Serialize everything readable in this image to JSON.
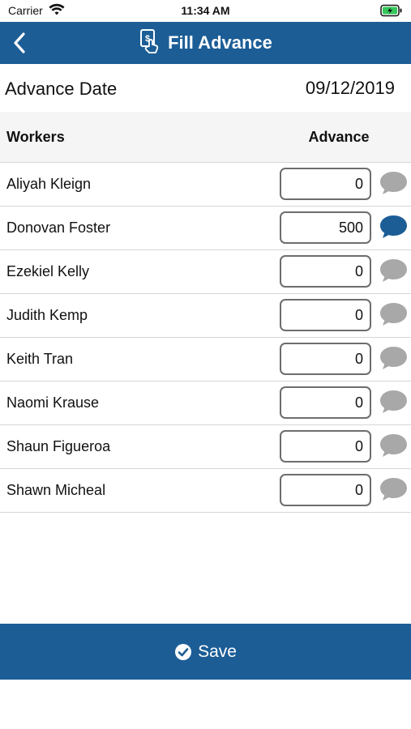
{
  "status_bar": {
    "carrier": "Carrier",
    "time": "11:34 AM"
  },
  "nav": {
    "title": "Fill Advance",
    "back_icon": "chevron-left-icon",
    "title_icon": "hand-money-icon",
    "color": "#1c5d96"
  },
  "advance_date": {
    "label": "Advance Date",
    "value": "09/12/2019"
  },
  "table": {
    "headers": {
      "workers": "Workers",
      "advance": "Advance"
    },
    "rows": [
      {
        "name": "Aliyah Kleign",
        "advance": "0",
        "has_comment": false
      },
      {
        "name": "Donovan Foster",
        "advance": "500",
        "has_comment": true
      },
      {
        "name": "Ezekiel Kelly",
        "advance": "0",
        "has_comment": false
      },
      {
        "name": "Judith Kemp",
        "advance": "0",
        "has_comment": false
      },
      {
        "name": "Keith Tran",
        "advance": "0",
        "has_comment": false
      },
      {
        "name": "Naomi Krause",
        "advance": "0",
        "has_comment": false
      },
      {
        "name": "Shaun Figueroa",
        "advance": "0",
        "has_comment": false
      },
      {
        "name": "Shawn Micheal",
        "advance": "0",
        "has_comment": false
      }
    ]
  },
  "save": {
    "label": "Save",
    "icon": "check-circle-icon"
  },
  "colors": {
    "primary": "#1c5d96",
    "comment_active": "#1c5d96",
    "comment_inactive": "#a8a8a8"
  }
}
